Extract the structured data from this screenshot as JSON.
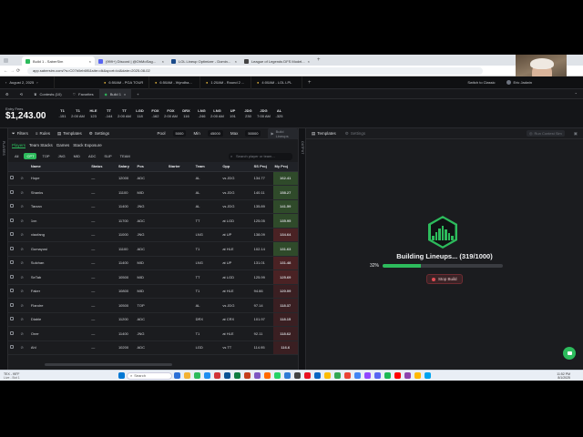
{
  "browser": {
    "tabs": [
      {
        "label": "Build 1 - SaberSim",
        "color": "#2dbb5c",
        "active": true
      },
      {
        "label": "(999+) Discord | @OhMoSag...",
        "color": "#5865f2"
      },
      {
        "label": "LOL Lineup Optimizer - Domin...",
        "color": "#1b4b8a"
      },
      {
        "label": "League of Legends DFS Model...",
        "color": "#444444"
      }
    ],
    "url": "app.sabersim.com/?s=C07b0eb6f0&site=dk&sport=lol&date=2025-08-02"
  },
  "contest_bar": {
    "date": "August 2, 2025",
    "contests": [
      {
        "label": "6:50AM - PGA TOUR"
      },
      {
        "label": "6:50AM - Wyndha..."
      },
      {
        "label": "1:20AM - Round 2 ..."
      },
      {
        "label": "4:00AM - LOL LPL"
      }
    ],
    "switch_label": "Switch to Classic",
    "user": "Eric Jadwin"
  },
  "builds_bar": {
    "contests_label": "Contests (10)",
    "favorites_label": "Favorites",
    "build_label": "Build 1"
  },
  "summary": {
    "entry_fees_label": "Entry Fees",
    "entry_fees": "$1,243.00"
  },
  "slates": [
    {
      "team": "T1",
      "line": "-151",
      "time": ""
    },
    {
      "team": "T1",
      "line": "",
      "time": "2:00 AM"
    },
    {
      "team": "HLE",
      "line": "123",
      "time": ""
    },
    {
      "team": "TT",
      "line": "-144",
      "time": ""
    },
    {
      "team": "TT",
      "line": "",
      "time": "2:00 AM"
    },
    {
      "team": "LGD",
      "line": "118",
      "time": ""
    },
    {
      "team": "FOX",
      "line": "-162",
      "time": ""
    },
    {
      "team": "FOX",
      "line": "",
      "time": "2:00 AM"
    },
    {
      "team": "DRX",
      "line": "116",
      "time": ""
    },
    {
      "team": "LNG",
      "line": "-246",
      "time": ""
    },
    {
      "team": "LNG",
      "line": "",
      "time": "2:00 AM"
    },
    {
      "team": "UP",
      "line": "191",
      "time": ""
    },
    {
      "team": "JDG",
      "line": "230",
      "time": ""
    },
    {
      "team": "JDG",
      "line": "",
      "time": "7:00 AM"
    },
    {
      "team": "AL",
      "line": "-325",
      "time": ""
    }
  ],
  "left_panel": {
    "filters_label": "Filters",
    "rules_label": "Rules",
    "templates_label": "Templates",
    "settings_label": "Settings",
    "pool_label": "Pool",
    "pool_value": "5000",
    "min_label": "Min",
    "min_value": "45000",
    "max_label": "Max",
    "max_value": "50000",
    "build_lineups_label": "Build Lineups",
    "tabs": [
      "Players",
      "Team Stacks",
      "Games",
      "Stack Exposure"
    ],
    "positions": [
      "All",
      "CPT",
      "TOP",
      "JNG",
      "MID",
      "ADC",
      "SUP",
      "TEAM"
    ],
    "active_position": "CPT",
    "search_placeholder": "Search player or team...",
    "columns": [
      "Name",
      "Status",
      "Salary",
      "Pos",
      "Starter",
      "Team",
      "Opp",
      "SS Proj",
      "My Proj"
    ],
    "rows": [
      {
        "name": "Hope",
        "status": "—",
        "salary": "12000",
        "pos": "ADC",
        "team": "AL",
        "opp": "vs JDG",
        "ss": "134.77",
        "my": "162.41",
        "heat": "hi"
      },
      {
        "name": "Shanks",
        "status": "—",
        "salary": "11100",
        "pos": "MID",
        "team": "AL",
        "opp": "vs JDG",
        "ss": "140.11",
        "my": "158.27",
        "heat": "hi"
      },
      {
        "name": "Tarzan",
        "status": "—",
        "salary": "11400",
        "pos": "JNG",
        "team": "AL",
        "opp": "vs JDG",
        "ss": "135.89",
        "my": "141.59",
        "heat": "hi"
      },
      {
        "name": "1xn",
        "status": "—",
        "salary": "11700",
        "pos": "ADC",
        "team": "TT",
        "opp": "at LGD",
        "ss": "125.05",
        "my": "135.95",
        "heat": "hi"
      },
      {
        "name": "xiaofang",
        "status": "—",
        "salary": "11000",
        "pos": "JNG",
        "team": "LNG",
        "opp": "at UP",
        "ss": "138.09",
        "my": "134.64",
        "heat": "mid"
      },
      {
        "name": "Gumayusi",
        "status": "—",
        "salary": "11100",
        "pos": "ADC",
        "team": "T1",
        "opp": "at HLE",
        "ss": "102.14",
        "my": "131.63",
        "heat": "hi"
      },
      {
        "name": "Sulchan",
        "status": "—",
        "salary": "11400",
        "pos": "MID",
        "team": "LNG",
        "opp": "at UP",
        "ss": "131.01",
        "my": "131.48",
        "heat": "mid"
      },
      {
        "name": "SeTab",
        "status": "—",
        "salary": "10500",
        "pos": "MID",
        "team": "TT",
        "opp": "at LGD",
        "ss": "125.99",
        "my": "125.69",
        "heat": "mid"
      },
      {
        "name": "Faker",
        "status": "—",
        "salary": "10800",
        "pos": "MID",
        "team": "T1",
        "opp": "at HLE",
        "ss": "94.66",
        "my": "120.09",
        "heat": "low"
      },
      {
        "name": "Flandre",
        "status": "—",
        "salary": "10500",
        "pos": "TOP",
        "team": "AL",
        "opp": "vs JDG",
        "ss": "97.14",
        "my": "118.37",
        "heat": "low"
      },
      {
        "name": "Diable",
        "status": "—",
        "salary": "11200",
        "pos": "ADC",
        "team": "DRX",
        "opp": "at CRX",
        "ss": "101.97",
        "my": "118.15",
        "heat": "low"
      },
      {
        "name": "Oner",
        "status": "—",
        "salary": "11400",
        "pos": "JNG",
        "team": "T1",
        "opp": "at HLE",
        "ss": "92.11",
        "my": "118.62",
        "heat": "low"
      },
      {
        "name": "Ahl",
        "status": "—",
        "salary": "10200",
        "pos": "ADC",
        "team": "LGD",
        "opp": "vs TT",
        "ss": "114.95",
        "my": "116.6",
        "heat": "low"
      }
    ]
  },
  "right_panel": {
    "templates_label": "Templates",
    "settings_label": "Settings",
    "run_sim_label": "Run Contest Sim",
    "building_text": "Building Lineups... (319/1000)",
    "progress_percent_label": "32%",
    "progress_value": 0.32,
    "stop_label": "Stop Build"
  },
  "taskbar": {
    "weather": "TEX - 95°F",
    "weather_sub": "Live - Bot 1",
    "search_placeholder": "Search",
    "time": "11:52 PM",
    "date": "8/1/2025"
  },
  "colors": {
    "accent": "#2dbb5c",
    "stop": "#6d2b31"
  }
}
